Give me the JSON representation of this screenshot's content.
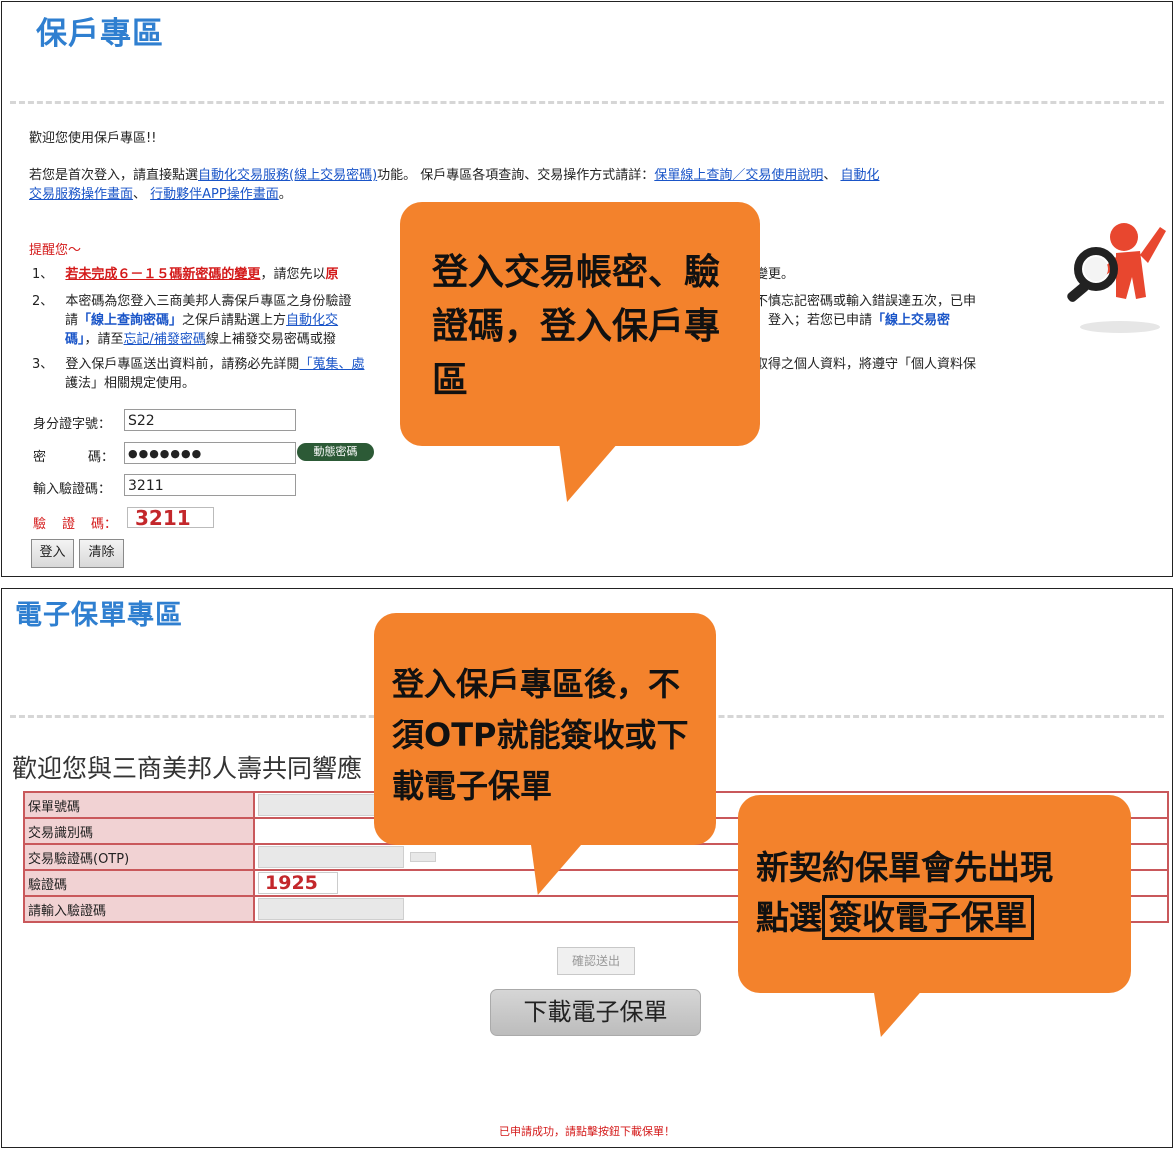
{
  "top": {
    "title": "保戶專區",
    "welcome": "歡迎您使用保戶專區!!",
    "intro": {
      "p1_before": "若您是首次登入，請直接點選",
      "link_auto": "自動化交易服務(線上交易密碼)",
      "p1_mid": "功能。 保戶專區各項查詢、交易操作方式請詳：",
      "link_guide": "保單線上查詢／交易使用說明",
      "sep": "、 ",
      "link_auto_op_a": "自動化",
      "link_auto_op_b": "交易服務操作畫面",
      "sep2": "、 ",
      "link_app": "行動夥伴APP操作畫面",
      "end": "。"
    },
    "reminder_title": "提醒您～",
    "reminder": {
      "n1": "1、",
      "n1_red": "若未完成６－１５碼新密碼的變更",
      "n1_a": "，請您先以",
      "n1_red2": "原",
      "n1_tail": "變更。",
      "n2": "2、",
      "n2_a": "本密碼為您登入三商美邦人壽保戶專區之身份驗證",
      "n2_right": "不慎忘記密碼或輸入錯誤達五次，已申",
      "n2_b1": "請",
      "n2_b_blue": "「線上查詢密碼」",
      "n2_b2": "之保戶請點選上方",
      "n2_b_link": "自動化交",
      "n2_b_right1": "」登入；若您已申請",
      "n2_b_right_blue": "「線上交易密",
      "n2_c_blue": "碼」",
      "n2_c1": "，請至",
      "n2_c_link": "忘記/補發密碼",
      "n2_c2": "線上補發交易密碼或撥",
      "n3": "3、",
      "n3_a": "登入保戶專區送出資料前，請務必先詳閱",
      "n3_link": "「蒐集、處",
      "n3_right": "取得之個人資料，將遵守「個人資料保",
      "n3_b": "護法」相關規定使用。"
    },
    "form": {
      "id_label": "身分證字號：",
      "id_value": "S22",
      "pwd_label_a": "密",
      "pwd_label_b": "碼：",
      "pwd_value": "●●●●●●●",
      "dyn_btn": "動態密碼",
      "cap_label": "輸入驗證碼：",
      "cap_value": "3211",
      "code_label_a": "驗",
      "code_label_b": "證",
      "code_label_c": "碼：",
      "code_value": "3211",
      "login_btn": "登入",
      "clear_btn": "清除"
    },
    "callout": "登入交易帳密、驗證碼，登入保戶專區"
  },
  "bottom": {
    "title": "電子保單專區",
    "welcome": "歡迎您與三商美邦人壽共同響應",
    "rows": [
      {
        "label": "保單號碼"
      },
      {
        "label": "交易識別碼"
      },
      {
        "label": "交易驗證碼(OTP)"
      },
      {
        "label": "驗證碼",
        "code": "1925"
      },
      {
        "label": "請輸入驗證碼"
      }
    ],
    "confirm_btn": "確認送出",
    "download_btn": "下載電子保單",
    "success_msg": "已申請成功，請點擊按鈕下載保單！",
    "callout1": "登入保戶專區後，不須OTP就能簽收或下載電子保單",
    "callout2_line1": "新契約保單會先出現",
    "callout2_pre": "點選",
    "callout2_box": "簽收電子保單"
  },
  "colors": {
    "accent_orange": "#f3822c",
    "title_blue": "#2f7fd0",
    "alert_red": "#d41a1a",
    "table_border": "#c9585b",
    "label_bg": "#f1d2d3"
  }
}
